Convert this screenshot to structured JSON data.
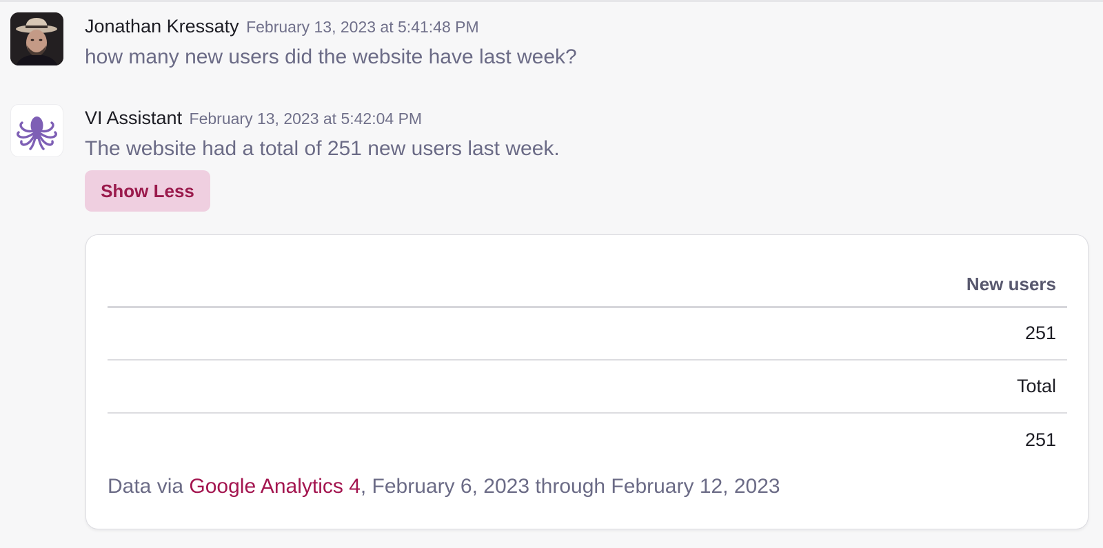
{
  "messages": [
    {
      "author": "Jonathan Kressaty",
      "timestamp": "February 13, 2023 at 5:41:48 PM",
      "text": "how many new users did the website have last week?",
      "avatar_icon": "user-photo-avatar"
    },
    {
      "author": "VI Assistant",
      "timestamp": "February 13, 2023 at 5:42:04 PM",
      "text": "The website had a total of 251 new users last week.",
      "avatar_icon": "octopus-icon",
      "toggle_label": "Show Less"
    }
  ],
  "result_table": {
    "column_header": "New users",
    "rows": [
      "251",
      "Total",
      "251"
    ]
  },
  "source": {
    "prefix": "Data via ",
    "link_text": "Google Analytics 4",
    "suffix": ", February 6, 2023 through February 12, 2023"
  },
  "colors": {
    "accent": "#a3154f",
    "button_bg": "#efcfe0",
    "octopus": "#7e5fb5",
    "page_bg": "#f7f7f8"
  }
}
